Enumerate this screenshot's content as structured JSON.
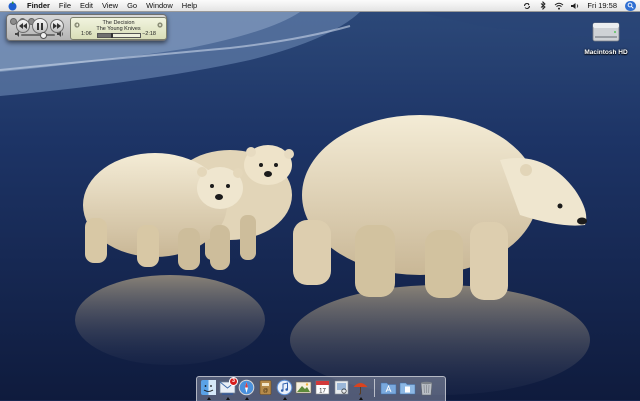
{
  "menubar": {
    "apple_icon": "apple-icon",
    "app_name": "Finder",
    "items": [
      "File",
      "Edit",
      "View",
      "Go",
      "Window",
      "Help"
    ],
    "status_icons": [
      "sync-icon",
      "bluetooth-icon",
      "wifi-icon",
      "volume-icon"
    ],
    "clock": "Fri 19:58",
    "spotlight_icon": "spotlight-icon"
  },
  "itunes_mini_player": {
    "track_title": "The Decision",
    "artist": "The Young Knives",
    "elapsed": "1:06",
    "remaining": "−2:18",
    "progress_fraction": 0.32,
    "volume_fraction": 0.65,
    "controls": [
      "previous-icon",
      "pause-icon",
      "next-icon"
    ]
  },
  "desktop": {
    "icons": [
      {
        "label": "Macintosh HD",
        "icon": "hard-drive-icon"
      }
    ]
  },
  "dock": {
    "apps": [
      {
        "name": "finder-icon",
        "running": true,
        "badge": ""
      },
      {
        "name": "mail-icon",
        "running": true,
        "badge": "3"
      },
      {
        "name": "safari-icon",
        "running": true,
        "badge": ""
      },
      {
        "name": "address-book-icon",
        "running": false,
        "badge": ""
      },
      {
        "name": "itunes-icon",
        "running": true,
        "badge": ""
      },
      {
        "name": "iphoto-icon",
        "running": false,
        "badge": ""
      },
      {
        "name": "ical-icon",
        "running": false,
        "badge": ""
      },
      {
        "name": "preview-icon",
        "running": false,
        "badge": ""
      },
      {
        "name": "umbrella-app-icon",
        "running": true,
        "badge": ""
      }
    ],
    "docs": [
      {
        "name": "applications-stack-icon"
      },
      {
        "name": "documents-stack-icon"
      },
      {
        "name": "trash-icon"
      }
    ]
  },
  "colors": {
    "water": "#17264f",
    "menubar": "#ececec",
    "lcd": "#e6ebc9",
    "badge": "#d61c1c"
  }
}
